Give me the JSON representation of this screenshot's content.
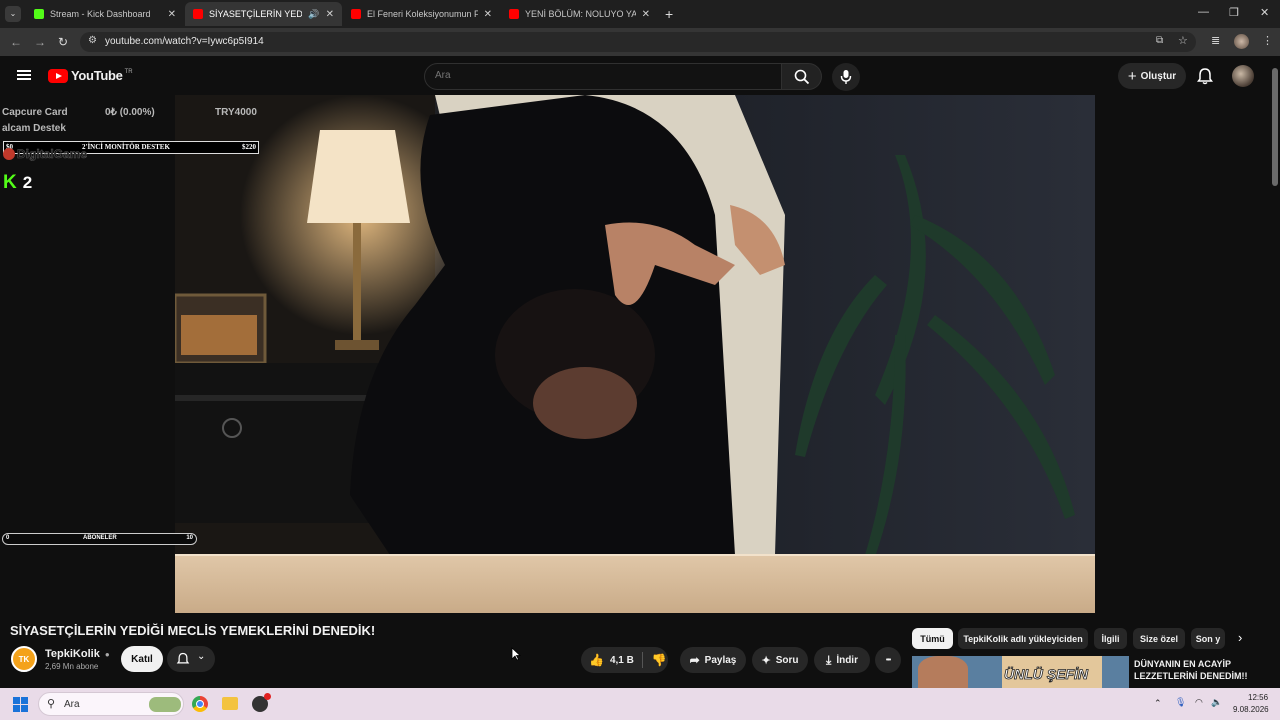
{
  "browser": {
    "tabs": [
      {
        "title": "Stream - Kick Dashboard",
        "active": false,
        "color": "#53fc18"
      },
      {
        "title": "SİYASETÇİLERİN YEDİĞİ ME",
        "active": true,
        "color": "#ff0000"
      },
      {
        "title": "El Feneri Koleksiyonumun Favo",
        "active": false,
        "color": "#ff0000"
      },
      {
        "title": "YENİ BÖLÜM: NOLUYO YA ¿ VS",
        "active": false,
        "color": "#ff0000"
      }
    ],
    "close_glyph": "✕",
    "new_tab_glyph": "+",
    "url": "youtube.com/watch?v=Iywc6p5I914"
  },
  "youtube": {
    "logo_text": "YouTube",
    "country_code": "TR",
    "search_placeholder": "Ara",
    "create_label": "Oluştur",
    "create_glyph": "+"
  },
  "overlay": {
    "goal": {
      "left": "$0",
      "title": "2'İNCİ MONİTÖR DESTEK",
      "right": "$220"
    },
    "capture": {
      "label": "Capcure Card",
      "progress": "0₺ (0.00%)",
      "target": "TRY4000"
    },
    "capture_second_line": "alcam Destek",
    "sponsor": "DigitalGame",
    "kick_count": "2",
    "subs_bar": {
      "left": "0",
      "title": "ABONELER",
      "right": "10"
    }
  },
  "video": {
    "title": "SİYASETÇİLERİN YEDİĞİ MECLİS YEMEKLERİNİ DENEDİK!",
    "channel": {
      "name": "TepkiKolik",
      "subscribers": "2,69 Mn abone",
      "avatar_text": "TK"
    },
    "join_label": "Katıl",
    "likes": "4,1 B",
    "share_label": "Paylaş",
    "ask_label": "Soru",
    "download_label": "İndir",
    "more_glyph": "•••"
  },
  "chips": [
    {
      "label": "Tümü",
      "active": true
    },
    {
      "label": "TepkiKolik adlı yükleyiciden",
      "active": false
    },
    {
      "label": "İlgili",
      "active": false
    },
    {
      "label": "Size özel",
      "active": false
    },
    {
      "label": "Son y",
      "active": false
    }
  ],
  "recommendation": {
    "title": "DÜNYANIN EN ACAYİP LEZZETLERİNİ DENEDİM!!",
    "thumb_text": "ÜNLÜ ŞEFİN"
  },
  "taskbar": {
    "search_label": "Ara",
    "time": "12:56",
    "date": "9.08.2026"
  },
  "colors": {
    "youtube_red": "#ff0000",
    "kick_green": "#53fc18",
    "page_bg": "#0f0f0f"
  }
}
